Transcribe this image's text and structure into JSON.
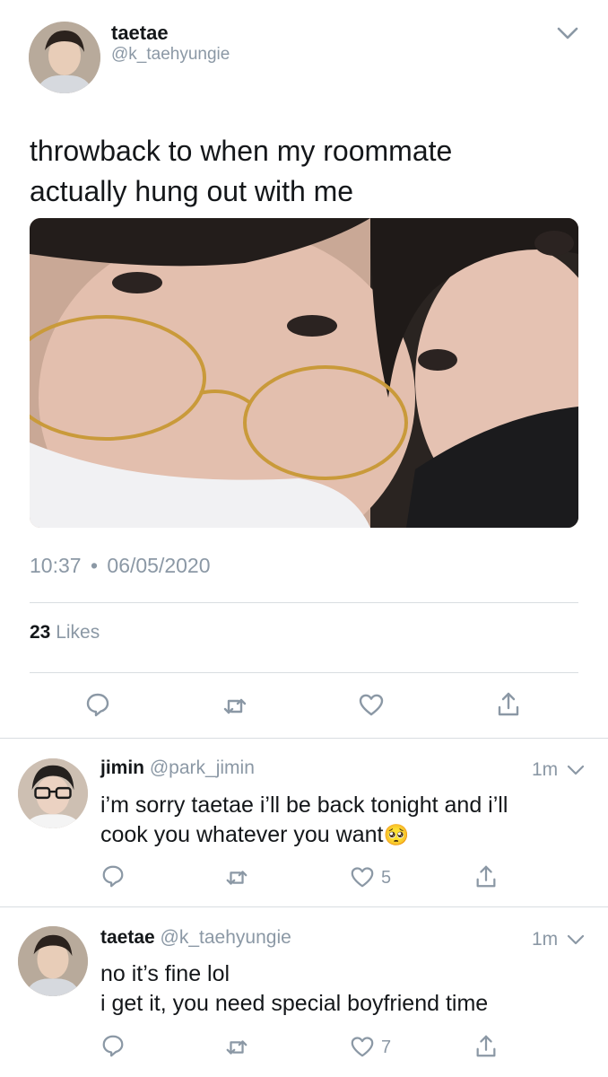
{
  "main_tweet": {
    "display_name": "taetae",
    "handle": "@k_taehyungie",
    "text_line1": "throwback to when my roommate",
    "text_line2": "actually hung out with me",
    "time": "10:37",
    "separator": "•",
    "date": "06/05/2020",
    "likes_count": "23",
    "likes_label": "Likes",
    "avatar_icon": "user-avatar-photo",
    "media_icon": "selfie-photo"
  },
  "replies": [
    {
      "display_name": "jimin",
      "handle": "@park_jimin",
      "time": "1m",
      "line1": "i’m sorry taetae i’ll be back tonight and i’ll",
      "line2": "cook you whatever you want",
      "emoji": "🥺",
      "like_count": "5"
    },
    {
      "display_name": "taetae",
      "handle": "@k_taehyungie",
      "time": "1m",
      "line1": "no it’s fine lol",
      "line2": "i get it, you need special boyfriend time",
      "like_count": "7"
    }
  ],
  "colors": {
    "text": "#14171a",
    "muted": "#8b98a5",
    "divider": "#d9dde1"
  }
}
